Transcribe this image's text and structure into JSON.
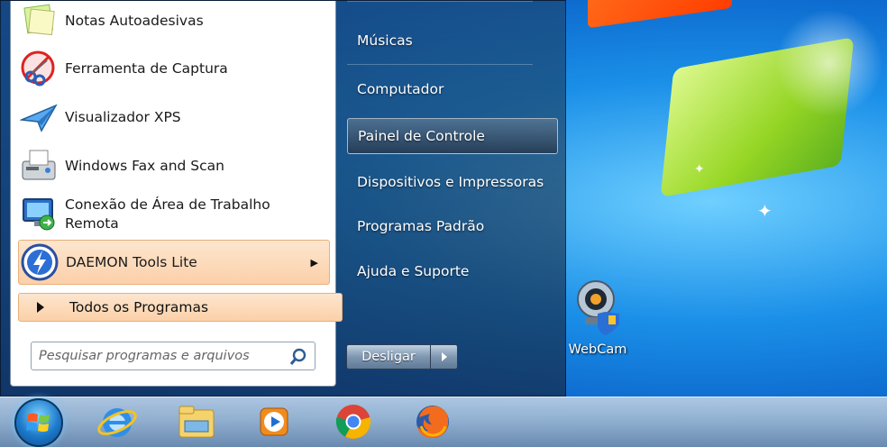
{
  "start_menu": {
    "programs": [
      {
        "label": "Notas Autoadesivas",
        "icon": "sticky-notes-icon"
      },
      {
        "label": "Ferramenta de Captura",
        "icon": "snipping-tool-icon"
      },
      {
        "label": "Visualizador XPS",
        "icon": "xps-viewer-icon"
      },
      {
        "label": "Windows Fax and Scan",
        "icon": "fax-scan-icon"
      },
      {
        "label_line1": "Conexão de Área de Trabalho",
        "label_line2": "Remota",
        "icon": "remote-desktop-icon"
      },
      {
        "label": "DAEMON Tools Lite",
        "icon": "daemon-tools-icon"
      }
    ],
    "all_programs_label": "Todos os Programas",
    "search_placeholder": "Pesquisar programas e arquivos",
    "right_items": [
      "Músicas",
      "Computador",
      "Painel de Controle",
      "Dispositivos e Impressoras",
      "Programas Padrão",
      "Ajuda e Suporte"
    ],
    "shutdown_label": "Desligar"
  },
  "desktop": {
    "icons": [
      {
        "label": "WebCam"
      }
    ]
  },
  "taskbar": {
    "icons": [
      "start-orb",
      "internet-explorer-icon",
      "file-explorer-icon",
      "media-player-icon",
      "chrome-icon",
      "firefox-icon"
    ]
  },
  "colors": {
    "highlight": "#fbd0a8",
    "wallpaper": "#0b63c9"
  }
}
